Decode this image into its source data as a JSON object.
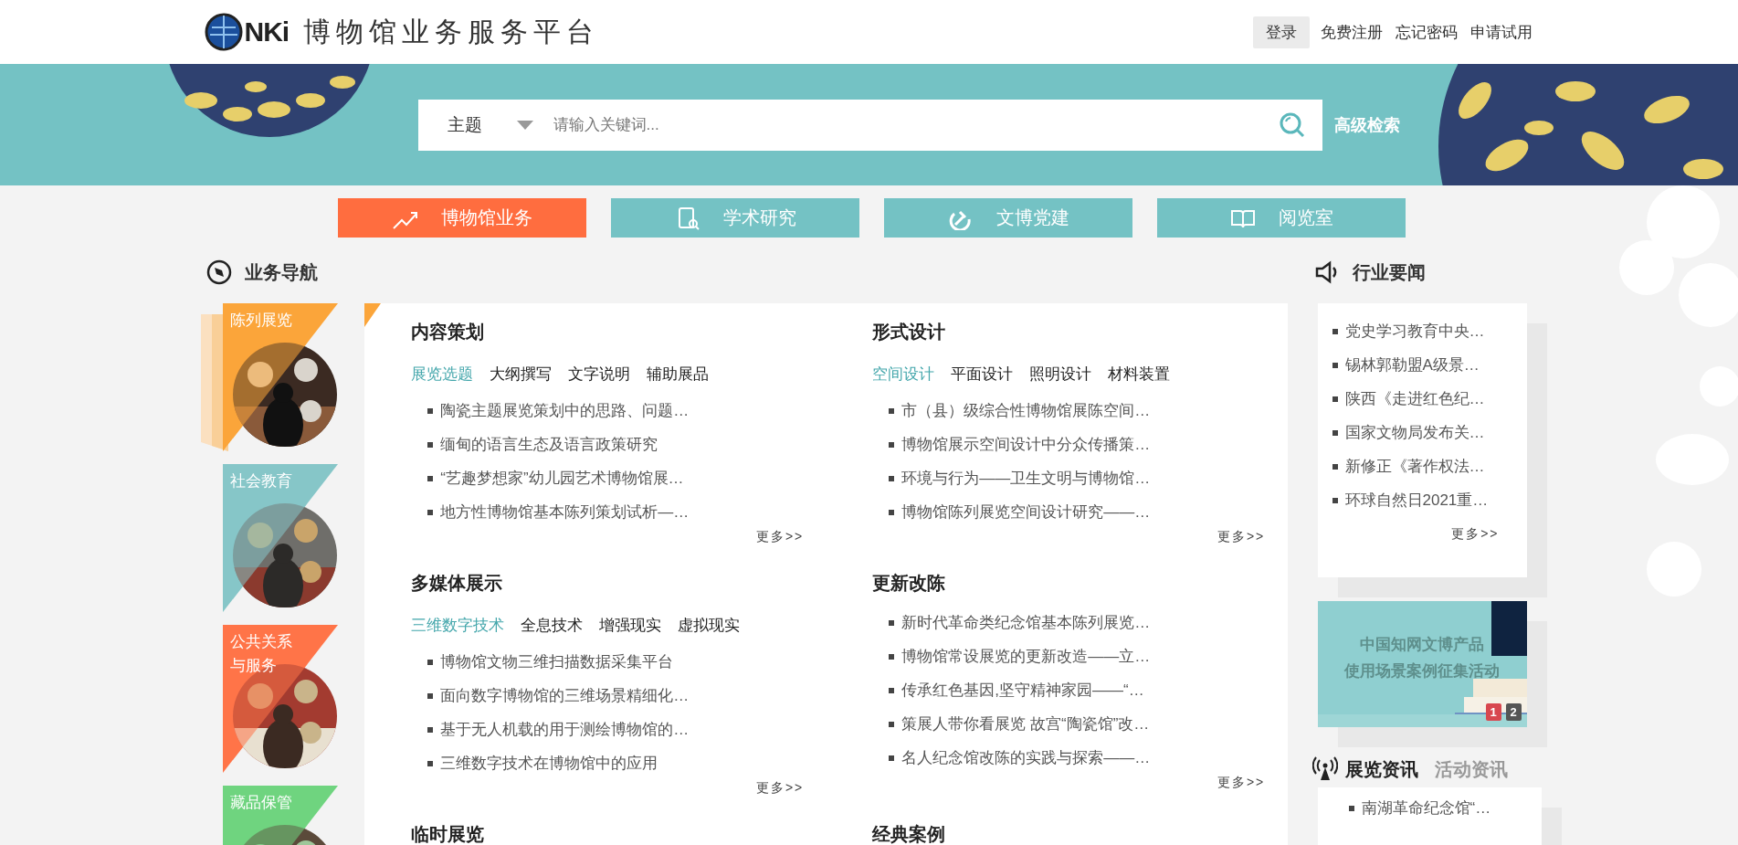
{
  "header": {
    "logo_mark": "NKi",
    "title": "博物馆业务服务平台",
    "links": [
      {
        "label": "登录",
        "kind": "button"
      },
      {
        "label": "免费注册",
        "kind": "link"
      },
      {
        "label": "忘记密码",
        "kind": "link"
      },
      {
        "label": "申请试用",
        "kind": "link"
      }
    ]
  },
  "search": {
    "field": "主题",
    "placeholder": "请输入关键词...",
    "advanced": "高级检索"
  },
  "tabs": [
    {
      "label": "博物馆业务",
      "kind": "trend",
      "selected": true
    },
    {
      "label": "学术研究",
      "kind": "document",
      "selected": false
    },
    {
      "label": "文博党建",
      "kind": "emblem",
      "selected": false
    },
    {
      "label": "阅览室",
      "kind": "book",
      "selected": false
    }
  ],
  "nav": {
    "title": "业务导航",
    "tiles": [
      {
        "label": "陈列展览",
        "color": "#fba53a",
        "selected": true
      },
      {
        "label": "社会教育",
        "color": "#86c6c8",
        "selected": false
      },
      {
        "label": "公共关系与服务",
        "color": "#ff7448",
        "selected": false
      },
      {
        "label": "藏品保管",
        "color": "#6fd47f",
        "selected": false
      }
    ]
  },
  "sections": [
    {
      "title": "内容策划",
      "subtabs": [
        {
          "label": "展览选题",
          "selected": true
        },
        {
          "label": "大纲撰写",
          "selected": false
        },
        {
          "label": "文字说明",
          "selected": false
        },
        {
          "label": "辅助展品",
          "selected": false
        }
      ],
      "items": [
        "陶瓷主题展览策划中的思路、问题…",
        "缅甸的语言生态及语言政策研究",
        "“艺趣梦想家”幼儿园艺术博物馆展…",
        "地方性博物馆基本陈列策划试析—…"
      ],
      "more": "更多>>"
    },
    {
      "title": "形式设计",
      "subtabs": [
        {
          "label": "空间设计",
          "selected": true
        },
        {
          "label": "平面设计",
          "selected": false
        },
        {
          "label": "照明设计",
          "selected": false
        },
        {
          "label": "材料装置",
          "selected": false
        }
      ],
      "items": [
        "市（县）级综合性博物馆展陈空间…",
        "博物馆展示空间设计中分众传播策…",
        "环境与行为——卫生文明与博物馆…",
        "博物馆陈列展览空间设计研究——…"
      ],
      "more": "更多>>"
    },
    {
      "title": "多媒体展示",
      "subtabs": [
        {
          "label": "三维数字技术",
          "selected": true
        },
        {
          "label": "全息技术",
          "selected": false
        },
        {
          "label": "增强现实",
          "selected": false
        },
        {
          "label": "虚拟现实",
          "selected": false
        }
      ],
      "items": [
        "博物馆文物三维扫描数据采集平台",
        "面向数字博物馆的三维场景精细化…",
        "基于无人机载的用于测绘博物馆的…",
        "三维数字技术在博物馆中的应用"
      ],
      "more": "更多>>"
    },
    {
      "title": "更新改陈",
      "items": [
        "新时代革命类纪念馆基本陈列展览…",
        "博物馆常设展览的更新改造——立…",
        "传承红色基因,坚守精神家园——“…",
        "策展人带你看展览 故宫“陶瓷馆”改…",
        "名人纪念馆改陈的实践与探索——…"
      ],
      "more": "更多>>"
    },
    {
      "title": "临时展览"
    },
    {
      "title": "经典案例"
    }
  ],
  "news": {
    "title": "行业要闻",
    "items": [
      "党史学习教育中央…",
      "锡林郭勒盟A级景…",
      "陕西《走进红色纪…",
      "国家文物局发布关…",
      "新修正《著作权法…",
      "环球自然日2021重…"
    ],
    "more": "更多>>"
  },
  "banner": {
    "lines": [
      "中国知网文博产品",
      "使用场景案例征集活动"
    ],
    "pages": [
      {
        "label": "1",
        "selected": true
      },
      {
        "label": "2",
        "selected": false
      }
    ]
  },
  "info": {
    "tabs": [
      {
        "label": "展览资讯",
        "selected": true
      },
      {
        "label": "活动资讯",
        "selected": false
      }
    ],
    "items": [
      "南湖革命纪念馆“…"
    ]
  }
}
